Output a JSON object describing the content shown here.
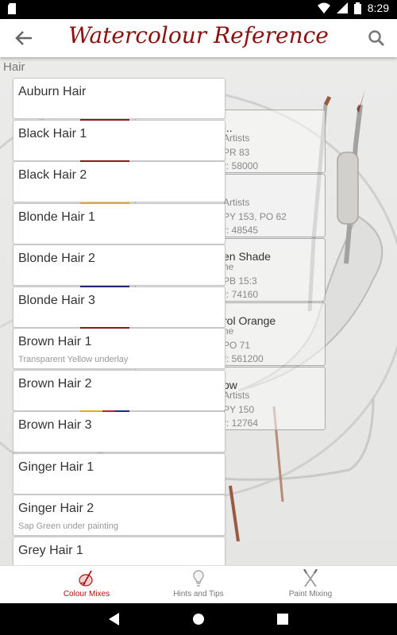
{
  "status_bar": {
    "time": "8:29"
  },
  "app_bar": {
    "title": "Watercolour Reference"
  },
  "section": {
    "label": "Hair"
  },
  "background_cards": [
    {
      "title": "...",
      "lines": [
        "Artists",
        "PR 83",
        "r: 58000"
      ]
    },
    {
      "title": "",
      "lines": [
        "Artists",
        "PY 153, PO 62",
        "r: 48545"
      ]
    },
    {
      "title": "en Shade",
      "lines": [
        "ne",
        "PB 15:3",
        "r: 74160"
      ]
    },
    {
      "title": "rol Orange",
      "lines": [
        "ne",
        "PO 71",
        "r: 561200"
      ]
    },
    {
      "title": "ow",
      "lines": [
        "Artists",
        "PY 150",
        "r: 12764"
      ]
    }
  ],
  "dropdown_items": [
    {
      "name": "Auburn Hair",
      "sub": ""
    },
    {
      "name": "Black Hair 1",
      "sub": ""
    },
    {
      "name": "Black Hair 2",
      "sub": ""
    },
    {
      "name": "Blonde Hair 1",
      "sub": ""
    },
    {
      "name": "Blonde Hair 2",
      "sub": ""
    },
    {
      "name": "Blonde Hair 3",
      "sub": ""
    },
    {
      "name": "Brown Hair 1",
      "sub": "Transparent Yellow underlay"
    },
    {
      "name": "Brown Hair 2",
      "sub": ""
    },
    {
      "name": "Brown Hair 3",
      "sub": ""
    },
    {
      "name": "Ginger Hair 1",
      "sub": ""
    },
    {
      "name": "Ginger Hair 2",
      "sub": "Sap Green under painting"
    },
    {
      "name": "Grey Hair 1",
      "sub": ""
    }
  ],
  "bottom_nav": {
    "tabs": [
      {
        "label": "Colour Mixes",
        "icon": "brush-palette-icon",
        "active": true
      },
      {
        "label": "Hints and Tips",
        "icon": "lightbulb-icon",
        "active": false
      },
      {
        "label": "Paint Mixing",
        "icon": "crossed-brushes-icon",
        "active": false
      }
    ]
  },
  "colors": {
    "accent": "#b01010",
    "title": "#8b1010"
  }
}
